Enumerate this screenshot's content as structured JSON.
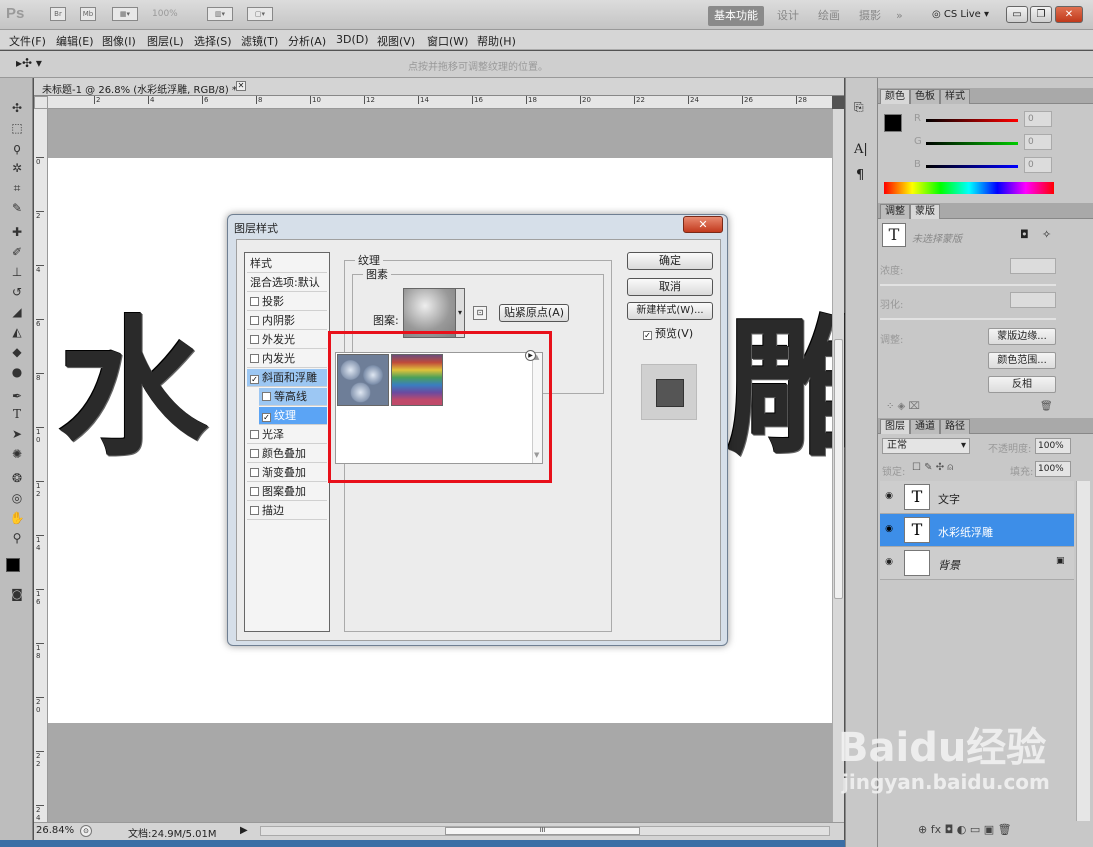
{
  "app": {
    "logo": "Ps",
    "zoom_display": "100%"
  },
  "workspaces": {
    "items": [
      "基本功能",
      "设计",
      "绘画",
      "摄影"
    ],
    "more": "»",
    "cslive": "CS Live"
  },
  "menu": [
    "文件(F)",
    "编辑(E)",
    "图像(I)",
    "图层(L)",
    "选择(S)",
    "滤镜(T)",
    "分析(A)",
    "3D(D)",
    "视图(V)",
    "窗口(W)",
    "帮助(H)"
  ],
  "options_bar": {
    "hint": "点按并拖移可调整纹理的位置。"
  },
  "document": {
    "tab_title": "未标题-1 @ 26.8% (水彩纸浮雕, RGB/8) *",
    "canvas_text_left": "水",
    "canvas_text_right": "雕",
    "ruler_h": [
      "2",
      "4",
      "6",
      "8",
      "10",
      "12",
      "14",
      "16",
      "18",
      "20",
      "22",
      "24",
      "26",
      "28"
    ],
    "ruler_v": [
      "0",
      "2",
      "4",
      "6",
      "8",
      "1 0",
      "1 2",
      "1 4",
      "1 6",
      "1 8",
      "2 0",
      "2 2",
      "2 4"
    ]
  },
  "statusbar": {
    "zoom": "26.84%",
    "doc": "文档:24.9M/5.01M",
    "scroll_grip": "III"
  },
  "color_panel": {
    "tabs": [
      "颜色",
      "色板",
      "样式"
    ],
    "channels": [
      {
        "label": "R",
        "value": "0"
      },
      {
        "label": "G",
        "value": "0"
      },
      {
        "label": "B",
        "value": "0"
      }
    ]
  },
  "adjust_panel": {
    "tabs": [
      "调整",
      "蒙版"
    ],
    "mask_title": "未选择蒙版",
    "density": "浓度:",
    "feather": "羽化:",
    "refine": "调整:",
    "buttons": [
      "蒙版边缘...",
      "颜色范围...",
      "反相"
    ]
  },
  "layers_panel": {
    "tabs": [
      "图层",
      "通道",
      "路径"
    ],
    "blend_mode": "正常",
    "opacity_label": "不透明度:",
    "opacity": "100%",
    "lock_label": "锁定:",
    "fill_label": "填充:",
    "fill": "100%",
    "layers": [
      {
        "name": "文字",
        "thumb": "T",
        "selected": false
      },
      {
        "name": "水彩纸浮雕",
        "thumb": "T",
        "selected": true
      },
      {
        "name": "背景",
        "thumb": "",
        "selected": false
      }
    ]
  },
  "dialog": {
    "title": "图层样式",
    "close": "✕",
    "styles_header": "样式",
    "blend_options": "混合选项:默认",
    "style_items": [
      {
        "label": "投影",
        "checked": false
      },
      {
        "label": "内阴影",
        "checked": false
      },
      {
        "label": "外发光",
        "checked": false
      },
      {
        "label": "内发光",
        "checked": false
      },
      {
        "label": "斜面和浮雕",
        "checked": true
      },
      {
        "label": "等高线",
        "checked": false
      },
      {
        "label": "纹理",
        "checked": true
      },
      {
        "label": "光泽",
        "checked": false
      },
      {
        "label": "颜色叠加",
        "checked": false
      },
      {
        "label": "渐变叠加",
        "checked": false
      },
      {
        "label": "图案叠加",
        "checked": false
      },
      {
        "label": "描边",
        "checked": false
      }
    ],
    "texture_group": "纹理",
    "pattern_group": "图素",
    "pattern_label": "图案:",
    "snap_button": "贴紧原点(A)",
    "ok": "确定",
    "cancel": "取消",
    "new_style": "新建样式(W)...",
    "preview_label": "预览(V)",
    "preview_checked": true
  },
  "watermark": {
    "brand": "Baidu经验",
    "url": "jingyan.baidu.com"
  }
}
